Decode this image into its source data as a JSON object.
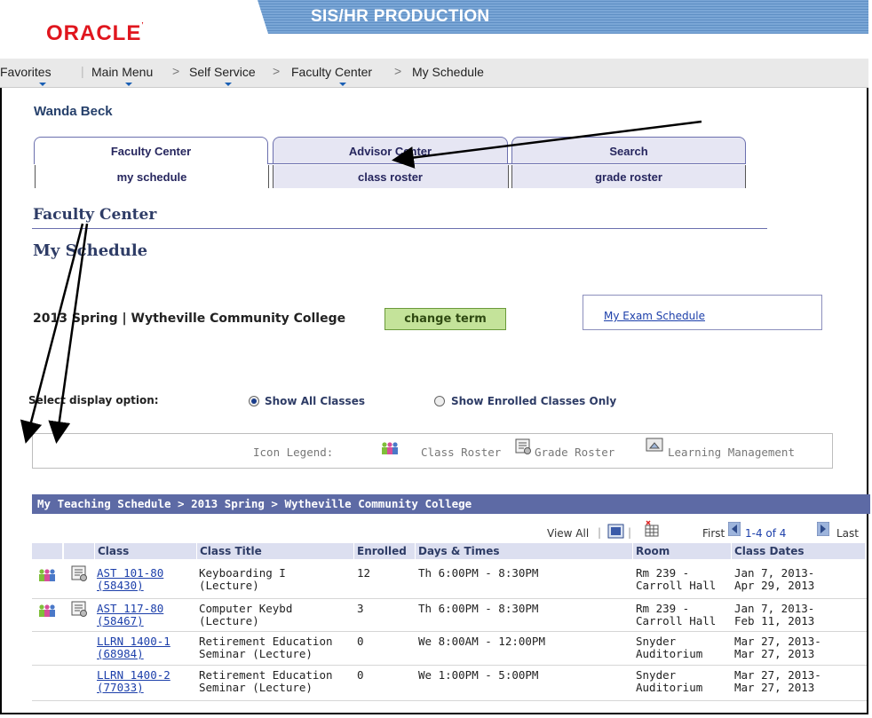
{
  "banner": {
    "logo": "ORACLE",
    "title": "SIS/HR PRODUCTION"
  },
  "nav": {
    "favorites": "Favorites",
    "main_menu": "Main Menu",
    "self_service": "Self Service",
    "faculty_center": "Faculty Center",
    "my_schedule": "My Schedule",
    "separator": ">"
  },
  "user_name": "Wanda Beck",
  "tabs": [
    "Faculty Center",
    "Advisor Center",
    "Search"
  ],
  "subtabs": [
    "my schedule",
    "class roster",
    "grade roster"
  ],
  "headings": {
    "center": "Faculty Center",
    "page": "My Schedule"
  },
  "term": {
    "text": "2013 Spring | Wytheville Community College",
    "change_term": "change term",
    "exam_link": "My Exam Schedule"
  },
  "display": {
    "label": "Select display option:",
    "options": [
      "Show All Classes",
      "Show Enrolled Classes Only"
    ],
    "selected": "Show All Classes"
  },
  "legend": {
    "label": "Icon Legend:",
    "items": [
      "Class Roster",
      "Grade Roster",
      "Learning Management"
    ]
  },
  "grid": {
    "title": "My Teaching Schedule > 2013 Spring > Wytheville Community College",
    "view_all": "View All",
    "first": "First",
    "range": "1-4 of 4",
    "last": "Last",
    "columns": [
      "Class",
      "Class Title",
      "Enrolled",
      "Days & Times",
      "Room",
      "Class Dates"
    ],
    "rows": [
      {
        "class1": "AST 101-80",
        "class2": "(58430)",
        "title1": "Keyboarding I",
        "title2": "(Lecture)",
        "enrolled": "12",
        "days": "Th 6:00PM - 8:30PM",
        "room1": "Rm 239 -",
        "room2": "Carroll Hall",
        "dates1": "Jan 7, 2013-",
        "dates2": "Apr 29, 2013"
      },
      {
        "class1": "AST 117-80",
        "class2": "(58467)",
        "title1": "Computer Keybd",
        "title2": "(Lecture)",
        "enrolled": "3",
        "days": "Th 6:00PM - 8:30PM",
        "room1": "Rm 239 -",
        "room2": "Carroll Hall",
        "dates1": "Jan 7, 2013-",
        "dates2": "Feb 11, 2013"
      },
      {
        "class1": "LLRN 1400-1",
        "class2": "(68984)",
        "title1": "Retirement Education",
        "title2": "Seminar (Lecture)",
        "enrolled": "0",
        "days": "We 8:00AM - 12:00PM",
        "room1": "Snyder",
        "room2": "Auditorium",
        "dates1": "Mar 27, 2013-",
        "dates2": "Mar 27, 2013"
      },
      {
        "class1": "LLRN 1400-2",
        "class2": "(77033)",
        "title1": "Retirement Education",
        "title2": "Seminar (Lecture)",
        "enrolled": "0",
        "days": "We 1:00PM - 5:00PM",
        "room1": "Snyder",
        "room2": "Auditorium",
        "dates1": "Mar 27, 2013-",
        "dates2": "Mar 27, 2013"
      }
    ]
  },
  "colors": {
    "oracle_red": "#e0161e",
    "banner_blue": "#6b9bd0",
    "grid_header": "#5d6aa5",
    "button_green": "#c4e39a",
    "link": "#1c3faa"
  }
}
